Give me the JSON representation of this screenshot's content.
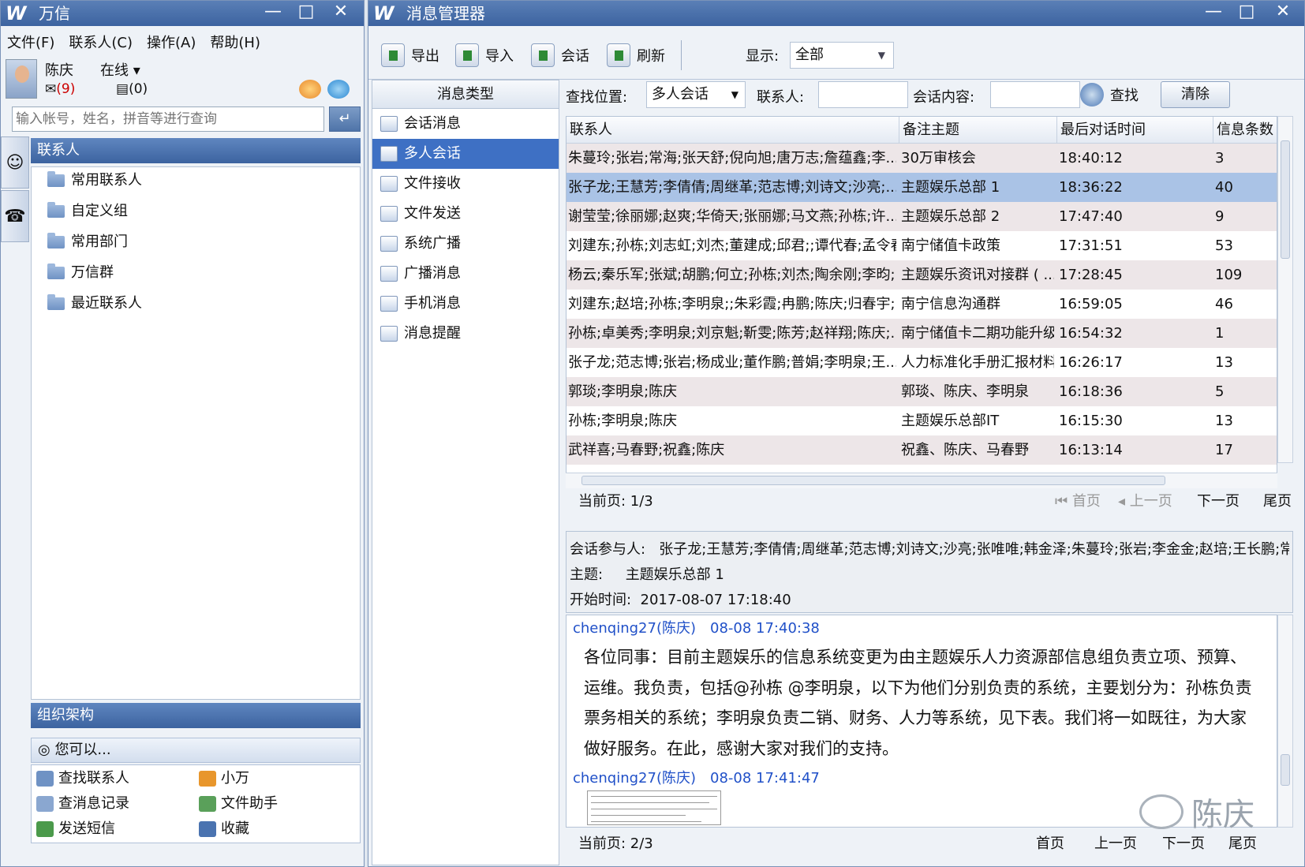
{
  "left_window": {
    "title": "万信",
    "menu": [
      "文件(F)",
      "联系人(C)",
      "操作(A)",
      "帮助(H)"
    ],
    "user": {
      "name": "陈庆",
      "status": "在线",
      "status_arrow": "▾",
      "mail_count": "(9)",
      "sms_count": "(0)"
    },
    "search_placeholder": "输入帐号，姓名，拼音等进行查询",
    "search_go": "↵",
    "contacts_header": "联系人",
    "tree": [
      "常用联系人",
      "自定义组",
      "常用部门",
      "万信群",
      "最近联系人"
    ],
    "org_header": "组织架构",
    "you_can": "您可以...",
    "quick_actions": [
      "查找联系人",
      "小万",
      "查消息记录",
      "文件助手",
      "发送短信",
      "收藏"
    ]
  },
  "right_window": {
    "title": "消息管理器",
    "toolbar": {
      "export": "导出",
      "import": "导入",
      "session": "会话",
      "refresh": "刷新",
      "show_label": "显示:",
      "show_value": "全部"
    },
    "types_header": "消息类型",
    "types": [
      "会话消息",
      "多人会话",
      "文件接收",
      "文件发送",
      "系统广播",
      "广播消息",
      "手机消息",
      "消息提醒"
    ],
    "selected_type": "多人会话",
    "search": {
      "location_label": "查找位置:",
      "location_value": "多人会话",
      "contact_label": "联系人:",
      "content_label": "会话内容:",
      "find": "查找",
      "clear": "清除"
    },
    "grid": {
      "headers": [
        "联系人",
        "备注主题",
        "最后对话时间",
        "信息条数"
      ],
      "rows": [
        [
          "朱蔓玲;张岩;常海;张天舒;倪向旭;唐万志;詹蕴鑫;李...",
          "30万审核会",
          "18:40:12",
          "3"
        ],
        [
          "张子龙;王慧芳;李倩倩;周继革;范志博;刘诗文;沙亮;...",
          "主题娱乐总部 1",
          "18:36:22",
          "40"
        ],
        [
          "谢莹莹;徐丽娜;赵爽;华倚天;张丽娜;马文燕;孙栋;许...",
          "主题娱乐总部 2",
          "17:47:40",
          "9"
        ],
        [
          "刘建东;孙栋;刘志虹;刘杰;董建成;邱君;;谭代春;孟令春.",
          "南宁储值卡政策",
          "17:31:51",
          "53"
        ],
        [
          "杨云;秦乐军;张斌;胡鹏;何立;孙栋;刘杰;陶余刚;李昀;...",
          "主题娱乐资讯对接群 ( ...",
          "17:28:45",
          "109"
        ],
        [
          "刘建东;赵培;孙栋;李明泉;;朱彩霞;冉鹏;陈庆;归春宇;...",
          "南宁信息沟通群",
          "16:59:05",
          "46"
        ],
        [
          "孙栋;卓美秀;李明泉;刘京魁;靳雯;陈芳;赵祥翔;陈庆;...",
          "南宁储值卡二期功能升级",
          "16:54:32",
          "1"
        ],
        [
          "张子龙;范志博;张岩;杨成业;董作鹏;普娟;李明泉;王...",
          "人力标准化手册汇报材料",
          "16:26:17",
          "13"
        ],
        [
          "郭琰;李明泉;陈庆",
          "郭琰、陈庆、李明泉",
          "16:18:36",
          "5"
        ],
        [
          "孙栋;李明泉;陈庆",
          "主题娱乐总部IT",
          "16:15:30",
          "13"
        ],
        [
          "武祥喜;马春野;祝鑫;陈庆",
          "祝鑫、陈庆、马春野",
          "16:13:14",
          "17"
        ]
      ],
      "selected_row": 1
    },
    "pager1": {
      "current": "当前页: 1/3",
      "first": "首页",
      "prev": "上一页",
      "next": "下一页",
      "last": "尾页"
    },
    "conversation": {
      "participants_label": "会话参与人:",
      "participants": "张子龙;王慧芳;李倩倩;周继革;范志博;刘诗文;沙亮;张唯唯;韩金泽;朱蔓玲;张岩;李金金;赵培;王长鹏;常...",
      "subject_label": "主题:",
      "subject": "主题娱乐总部 1",
      "start_label": "开始时间:",
      "start": "2017-08-07 17:18:40"
    },
    "messages": [
      {
        "sender": "chenqing27(陈庆)",
        "time": "08-08 17:40:38",
        "body": "各位同事：目前主题娱乐的信息系统变更为由主题娱乐人力资源部信息组负责立项、预算、运维。我负责，包括@孙栋 @李明泉，以下为他们分别负责的系统，主要划分为：孙栋负责票务相关的系统；李明泉负责二销、财务、人力等系统，见下表。我们将一如既往，为大家做好服务。在此，感谢大家对我们的支持。"
      },
      {
        "sender": "chenqing27(陈庆)",
        "time": "08-08 17:41:47",
        "body": ""
      }
    ],
    "pager2": {
      "current": "当前页: 2/3",
      "first": "首页",
      "prev": "上一页",
      "next": "下一页",
      "last": "尾页"
    }
  },
  "watermark": "陈庆",
  "colors": {
    "titlebar": "#3c63a0",
    "selected": "#3e70c4",
    "row_selected": "#aac3e6",
    "row_alt": "#ede6e8",
    "sender_blue": "#2050c8"
  },
  "icons": [
    "logo-icon",
    "minimize-icon",
    "maximize-icon",
    "close-icon",
    "folder-icon",
    "search-icon",
    "export-icon",
    "import-icon",
    "chat-icon",
    "refresh-icon"
  ]
}
